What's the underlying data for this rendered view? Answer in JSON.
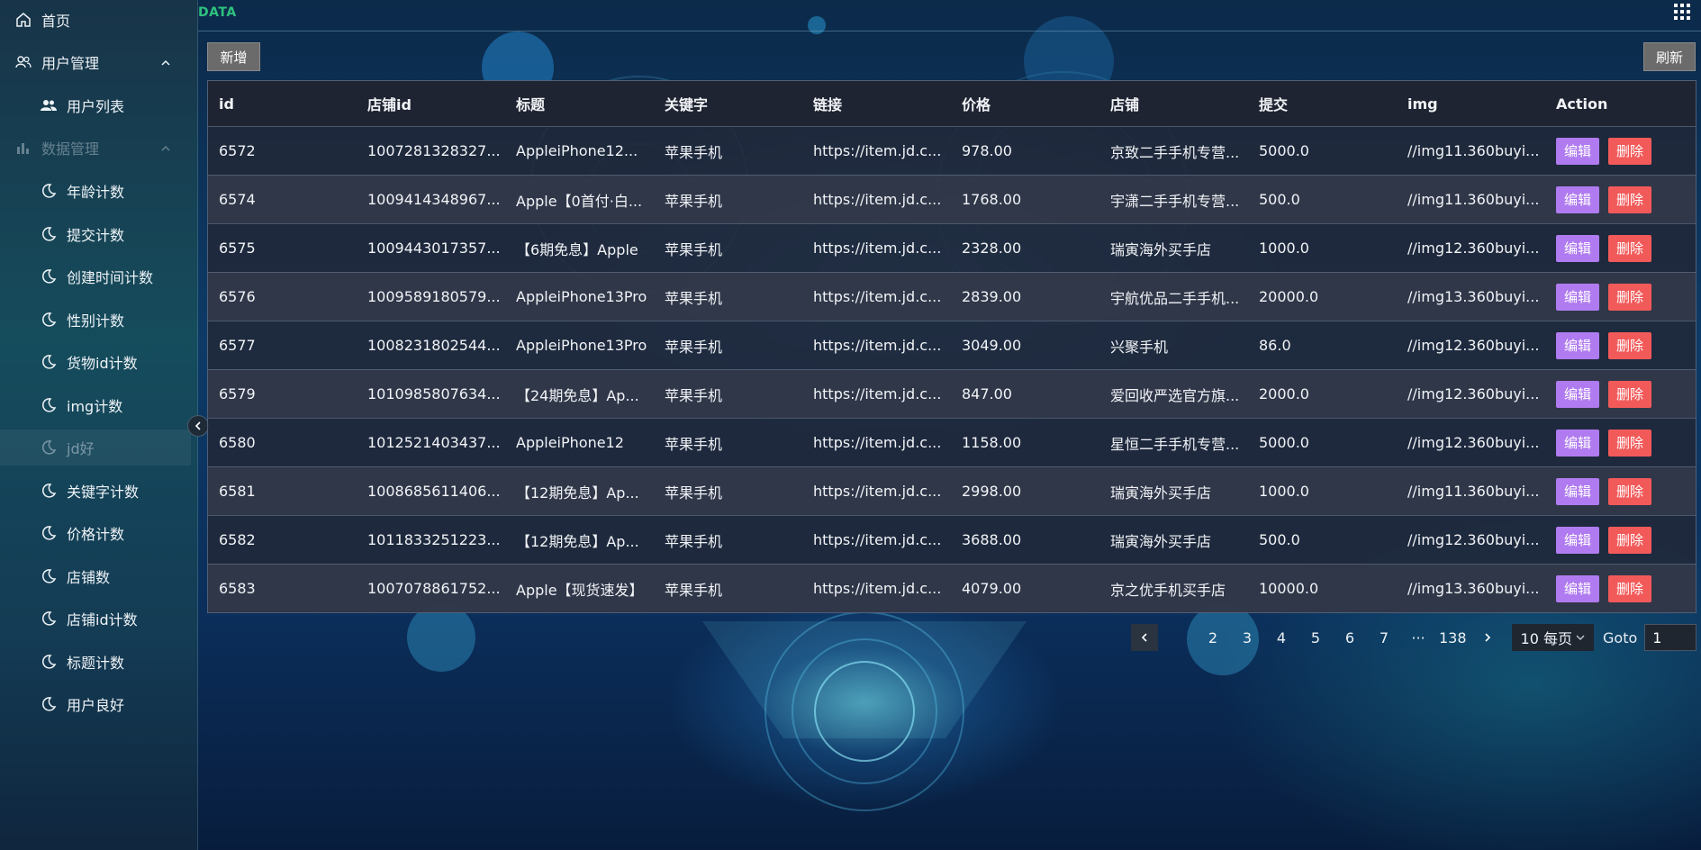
{
  "brand": "DATA",
  "sidebar": {
    "home": "首页",
    "user_mgmt": "用户管理",
    "user_list": "用户列表",
    "data_mgmt": "数据管理",
    "items": [
      "年龄计数",
      "提交计数",
      "创建时间计数",
      "性别计数",
      "货物id计数",
      "img计数",
      "jd好",
      "关键字计数",
      "价格计数",
      "店铺数",
      "店铺id计数",
      "标题计数",
      "用户良好"
    ]
  },
  "toolbar": {
    "add_label": "新增",
    "refresh_label": "刷新"
  },
  "table": {
    "columns": [
      "id",
      "店铺id",
      "标题",
      "关键字",
      "链接",
      "价格",
      "店铺",
      "提交",
      "img",
      "Action"
    ],
    "edit_label": "编辑",
    "delete_label": "删除",
    "rows": [
      [
        "6572",
        "1007281328327...",
        "AppleiPhone12...",
        "苹果手机",
        "https://item.jd.c...",
        "978.00",
        "京致二手手机专营...",
        "5000.0",
        "//img11.360buyi..."
      ],
      [
        "6574",
        "1009414348967...",
        "Apple【0首付·白...",
        "苹果手机",
        "https://item.jd.c...",
        "1768.00",
        "宇潇二手手机专营...",
        "500.0",
        "//img11.360buyi..."
      ],
      [
        "6575",
        "1009443017357...",
        "【6期免息】Apple",
        "苹果手机",
        "https://item.jd.c...",
        "2328.00",
        "瑞寅海外买手店",
        "1000.0",
        "//img12.360buyi..."
      ],
      [
        "6576",
        "1009589180579...",
        "AppleiPhone13Pro",
        "苹果手机",
        "https://item.jd.c...",
        "2839.00",
        "宇航优品二手手机...",
        "20000.0",
        "//img13.360buyi..."
      ],
      [
        "6577",
        "1008231802544...",
        "AppleiPhone13Pro",
        "苹果手机",
        "https://item.jd.c...",
        "3049.00",
        "兴聚手机",
        "86.0",
        "//img12.360buyi..."
      ],
      [
        "6579",
        "1010985807634...",
        "【24期免息】Ap...",
        "苹果手机",
        "https://item.jd.c...",
        "847.00",
        "爱回收严选官方旗...",
        "2000.0",
        "//img12.360buyi..."
      ],
      [
        "6580",
        "1012521403437...",
        "AppleiPhone12",
        "苹果手机",
        "https://item.jd.c...",
        "1158.00",
        "星恒二手手机专营...",
        "5000.0",
        "//img12.360buyi..."
      ],
      [
        "6581",
        "1008685611406...",
        "【12期免息】Ap...",
        "苹果手机",
        "https://item.jd.c...",
        "2998.00",
        "瑞寅海外买手店",
        "1000.0",
        "//img11.360buyi..."
      ],
      [
        "6582",
        "1011833251223...",
        "【12期免息】Ap...",
        "苹果手机",
        "https://item.jd.c...",
        "3688.00",
        "瑞寅海外买手店",
        "500.0",
        "//img12.360buyi..."
      ],
      [
        "6583",
        "1007078861752...",
        "Apple【现货速发】",
        "苹果手机",
        "https://item.jd.c...",
        "4079.00",
        "京之优手机买手店",
        "10000.0",
        "//img13.360buyi..."
      ]
    ]
  },
  "pagination": {
    "current": "1",
    "pages": [
      "2",
      "3",
      "4",
      "5",
      "6",
      "7",
      "···",
      "138"
    ],
    "per_page": "10 每页",
    "goto_label": "Goto",
    "goto_value": "1"
  }
}
